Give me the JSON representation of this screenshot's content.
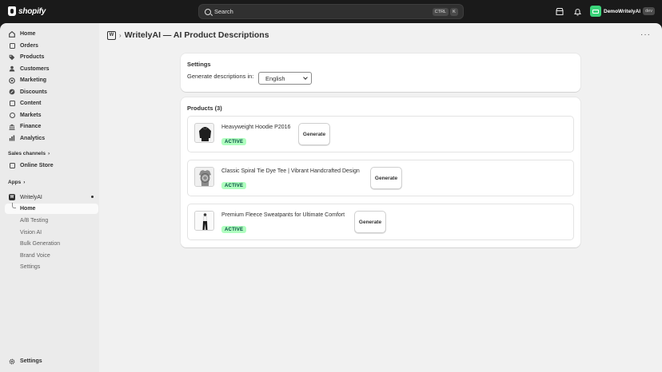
{
  "topbar": {
    "brand": "shopify",
    "search_placeholder": "Search",
    "shortcut_ctrl": "CTRL",
    "shortcut_k": "K",
    "account_name": "DemoWritelyAI",
    "account_badge": "dev"
  },
  "sidebar": {
    "items": [
      {
        "label": "Home",
        "icon": "home-icon"
      },
      {
        "label": "Orders",
        "icon": "orders-icon"
      },
      {
        "label": "Products",
        "icon": "tag-icon"
      },
      {
        "label": "Customers",
        "icon": "person-icon"
      },
      {
        "label": "Marketing",
        "icon": "target-icon"
      },
      {
        "label": "Discounts",
        "icon": "discount-icon"
      },
      {
        "label": "Content",
        "icon": "content-icon"
      },
      {
        "label": "Markets",
        "icon": "globe-icon"
      },
      {
        "label": "Finance",
        "icon": "bank-icon"
      },
      {
        "label": "Analytics",
        "icon": "chart-icon"
      }
    ],
    "sales_channels_label": "Sales channels",
    "online_store_label": "Online Store",
    "apps_label": "Apps",
    "app_name": "WritelyAI",
    "app_subitems": [
      "Home",
      "A/B Testing",
      "Vision AI",
      "Bulk Generation",
      "Brand Voice",
      "Settings"
    ],
    "settings_label": "Settings"
  },
  "page": {
    "app_badge": "W",
    "title": "WritelyAI — AI Product Descriptions"
  },
  "settings_card": {
    "title": "Settings",
    "generate_label": "Generate descriptions in:",
    "language": "English"
  },
  "products_card": {
    "title": "Products (3)",
    "button_label": "Generate",
    "products": [
      {
        "name": "Heavyweight Hoodie P2016",
        "status": "ACTIVE"
      },
      {
        "name": "Classic Spiral Tie Dye Tee | Vibrant Handcrafted Design",
        "status": "ACTIVE"
      },
      {
        "name": "Premium Fleece Sweatpants for Ultimate Comfort",
        "status": "ACTIVE"
      }
    ]
  },
  "colors": {
    "topbar": "#1a1a1a",
    "sidebar": "#ebebeb",
    "main": "#f1f1f1",
    "status_bg": "#affebf",
    "status_text": "#014b40"
  }
}
